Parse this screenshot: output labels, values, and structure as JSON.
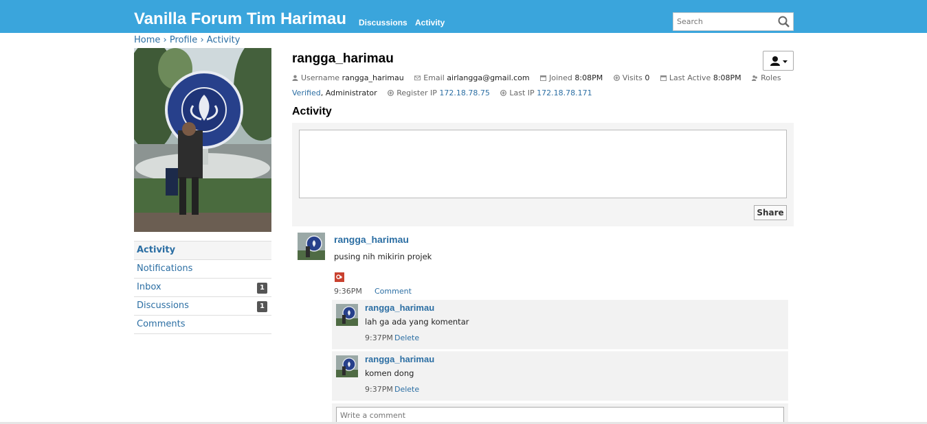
{
  "header": {
    "brand": "Vanilla Forum Tim Harimau",
    "nav": [
      "Discussions",
      "Activity"
    ],
    "search_placeholder": "Search"
  },
  "breadcrumb": [
    "Home",
    "Profile",
    "Activity"
  ],
  "sidebar": {
    "items": [
      {
        "label": "Activity",
        "count": null
      },
      {
        "label": "Notifications",
        "count": null
      },
      {
        "label": "Inbox",
        "count": "1"
      },
      {
        "label": "Discussions",
        "count": "1"
      },
      {
        "label": "Comments",
        "count": null
      }
    ]
  },
  "profile": {
    "name": "rangga_harimau",
    "username_label": "Username",
    "username": "rangga_harimau",
    "email_label": "Email",
    "email": "airlangga@gmail.com",
    "joined_label": "Joined",
    "joined": "8:08PM",
    "visits_label": "Visits",
    "visits": "0",
    "last_active_label": "Last Active",
    "last_active": "8:08PM",
    "roles_label": "Roles",
    "role_verified": "Verified",
    "role_sep": ",",
    "role_admin": "Administrator",
    "register_ip_label": "Register IP",
    "register_ip": "172.18.78.75",
    "last_ip_label": "Last IP",
    "last_ip": "172.18.78.171"
  },
  "activity": {
    "heading": "Activity",
    "share_label": "Share",
    "post": {
      "author": "rangga_harimau",
      "text": "pusing nih mikirin projek",
      "time": "9:36PM",
      "comment_link": "Comment"
    },
    "comments": [
      {
        "author": "rangga_harimau",
        "text": "lah ga ada yang komentar",
        "time": "9:37PM",
        "delete": "Delete"
      },
      {
        "author": "rangga_harimau",
        "text": "komen dong",
        "time": "9:37PM",
        "delete": "Delete"
      }
    ],
    "write_placeholder": "Write a comment"
  },
  "colors": {
    "header_bg": "#3aa5dc",
    "link": "#2b6ea3"
  }
}
